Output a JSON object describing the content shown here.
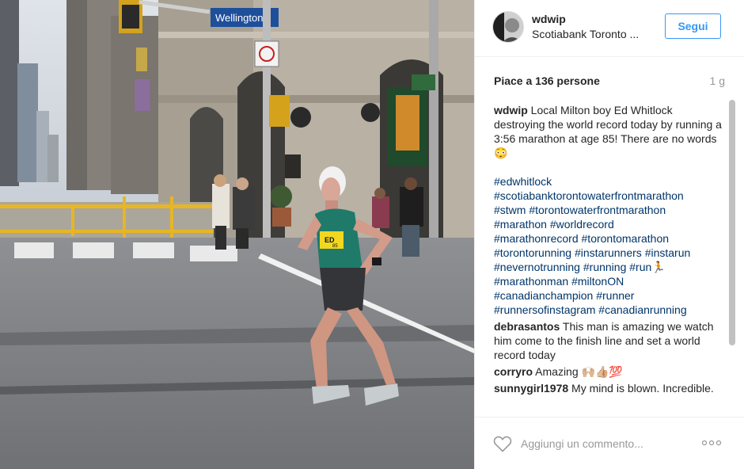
{
  "post": {
    "username": "wdwip",
    "location": "Scotiabank Toronto ...",
    "follow_label": "Segui",
    "likes": "Piace a 136 persone",
    "time_ago": "1 g"
  },
  "photo": {
    "street_sign": "Wellington",
    "bib_name": "ED",
    "bib_number": "85"
  },
  "caption": {
    "username": "wdwip",
    "text": "Local Milton boy Ed Whitlock destroying the world record today by running a 3:56 marathon at age 85! There are no words 😳",
    "hashtags": [
      "#edwhitlock",
      "#scotiabanktorontowaterfrontmarathon",
      "#stwm",
      "#torontowaterfrontmarathon",
      "#marathon",
      "#worldrecord",
      "#marathonrecord",
      "#torontomarathon",
      "#torontorunning",
      "#instarunners",
      "#instarun",
      "#nevernotrunning",
      "#running",
      "#run🏃",
      "#marathonman",
      "#miltonON",
      "#canadianchampion",
      "#runner",
      "#runnersofinstagram",
      "#canadianrunning"
    ]
  },
  "comments": [
    {
      "user": "debrasantos",
      "text": "This man is amazing we watch him come to the finish line and set a world record today"
    },
    {
      "user": "corryro",
      "text": "Amazing 🙌🏼👍🏼💯"
    },
    {
      "user": "sunnygirl1978",
      "text": "My mind is blown. Incredible."
    }
  ],
  "footer": {
    "comment_placeholder": "Aggiungi un commento...",
    "like_icon": "heart-outline-icon",
    "more_icon": "more-options-icon"
  },
  "colors": {
    "follow_blue": "#3897f0",
    "hashtag_blue": "#003569",
    "text": "#262626",
    "muted": "#999999"
  }
}
